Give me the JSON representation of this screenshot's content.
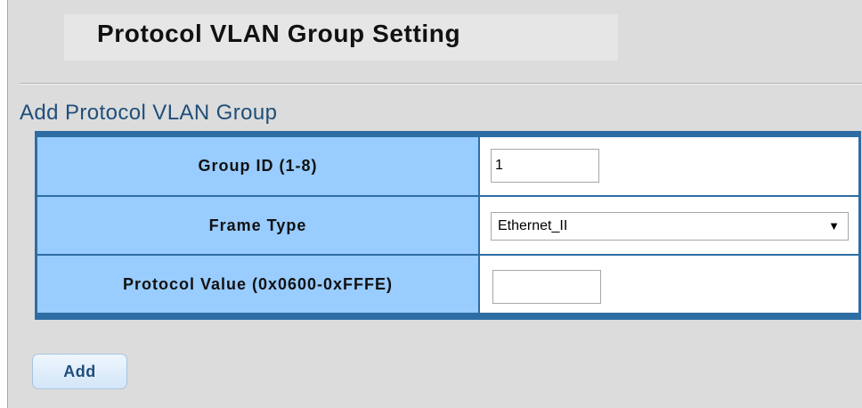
{
  "page": {
    "title": "Protocol VLAN Group Setting"
  },
  "section": {
    "title": "Add Protocol VLAN Group"
  },
  "form": {
    "rows": [
      {
        "label": "Group ID (1-8)",
        "value": "1"
      },
      {
        "label": "Frame Type",
        "selected": "Ethernet_II"
      },
      {
        "label": "Protocol Value (0x0600-0xFFFE)",
        "value": ""
      }
    ]
  },
  "actions": {
    "add_label": "Add"
  },
  "colors": {
    "panel_bg": "#dcdcdc",
    "table_border": "#2e6da4",
    "label_bg": "#99ccff",
    "section_title": "#1f4e79"
  }
}
